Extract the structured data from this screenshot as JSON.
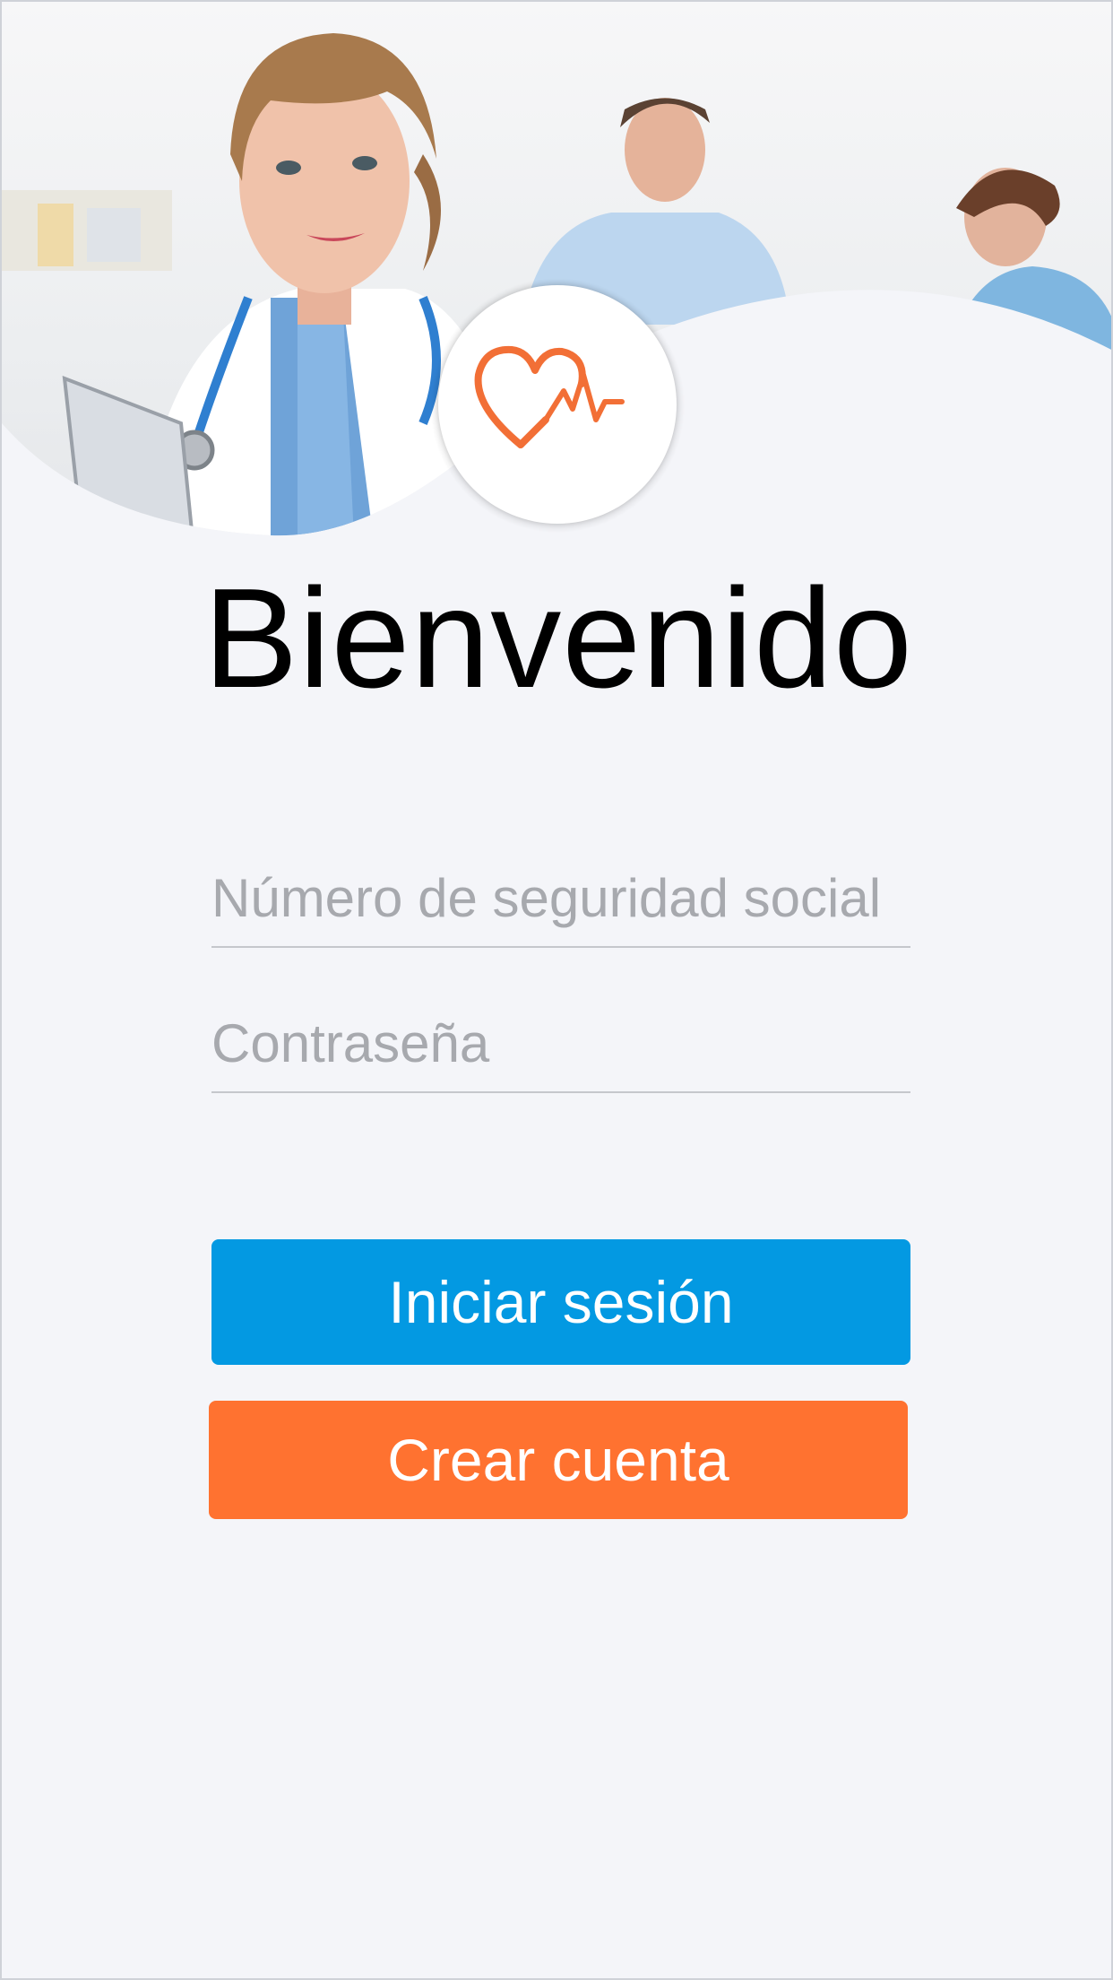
{
  "welcome": {
    "title": "Bienvenido"
  },
  "form": {
    "ssn_placeholder": "Número de seguridad social",
    "password_placeholder": "Contraseña"
  },
  "actions": {
    "login_label": "Iniciar sesión",
    "create_account_label": "Crear cuenta"
  },
  "colors": {
    "primary": "#0399e2",
    "secondary": "#ff7230",
    "background": "#f4f5f9",
    "logo_accent": "#f26f36"
  },
  "icons": {
    "logo": "heart-pulse-icon"
  }
}
